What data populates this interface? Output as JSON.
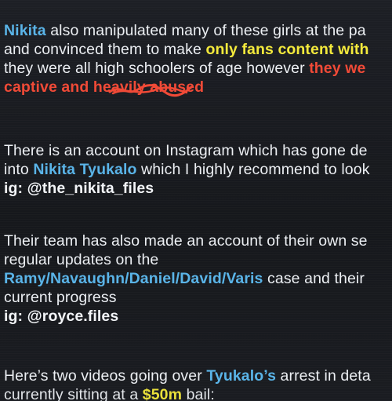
{
  "p1": {
    "l1_name": "Nikita",
    "l1_rest": " also manipulated many of these girls at the pa",
    "l2_a": "and convinced them to make ",
    "l2_b": "only fans content with",
    "l3_a": "they were all high schoolers of age however ",
    "l3_b": "they we",
    "l4_a": "captive and he",
    "l4_b": "avily abused"
  },
  "p2": {
    "l1": "There is an account on Instagram which has gone de",
    "l2_a": "into ",
    "l2_b": "Nikita Tyukalo",
    "l2_c": " which I highly recommend to look",
    "l3": "ig: @the_nikita_files"
  },
  "p3": {
    "l1": "Their team has also made an account of their own se",
    "l2": "regular updates on the",
    "l3_a": "Ramy/Navaughn/Daniel/David/Varis",
    "l3_b": " case and their",
    "l4": "current progress",
    "l5": "ig: @royce.files"
  },
  "p4": {
    "l1_a": "Here’s two videos going over ",
    "l1_b": "Tyukalo’s",
    "l1_c": " arrest in deta",
    "l2_a": "currently sitting at a ",
    "l2_b": "$50m",
    "l2_c": " bail:"
  },
  "colors": {
    "name_blue": "#5ab4e8",
    "highlight_yellow": "#f4ea3c",
    "highlight_red": "#f04a37",
    "text": "#eceff3",
    "background": "#181a1f"
  }
}
